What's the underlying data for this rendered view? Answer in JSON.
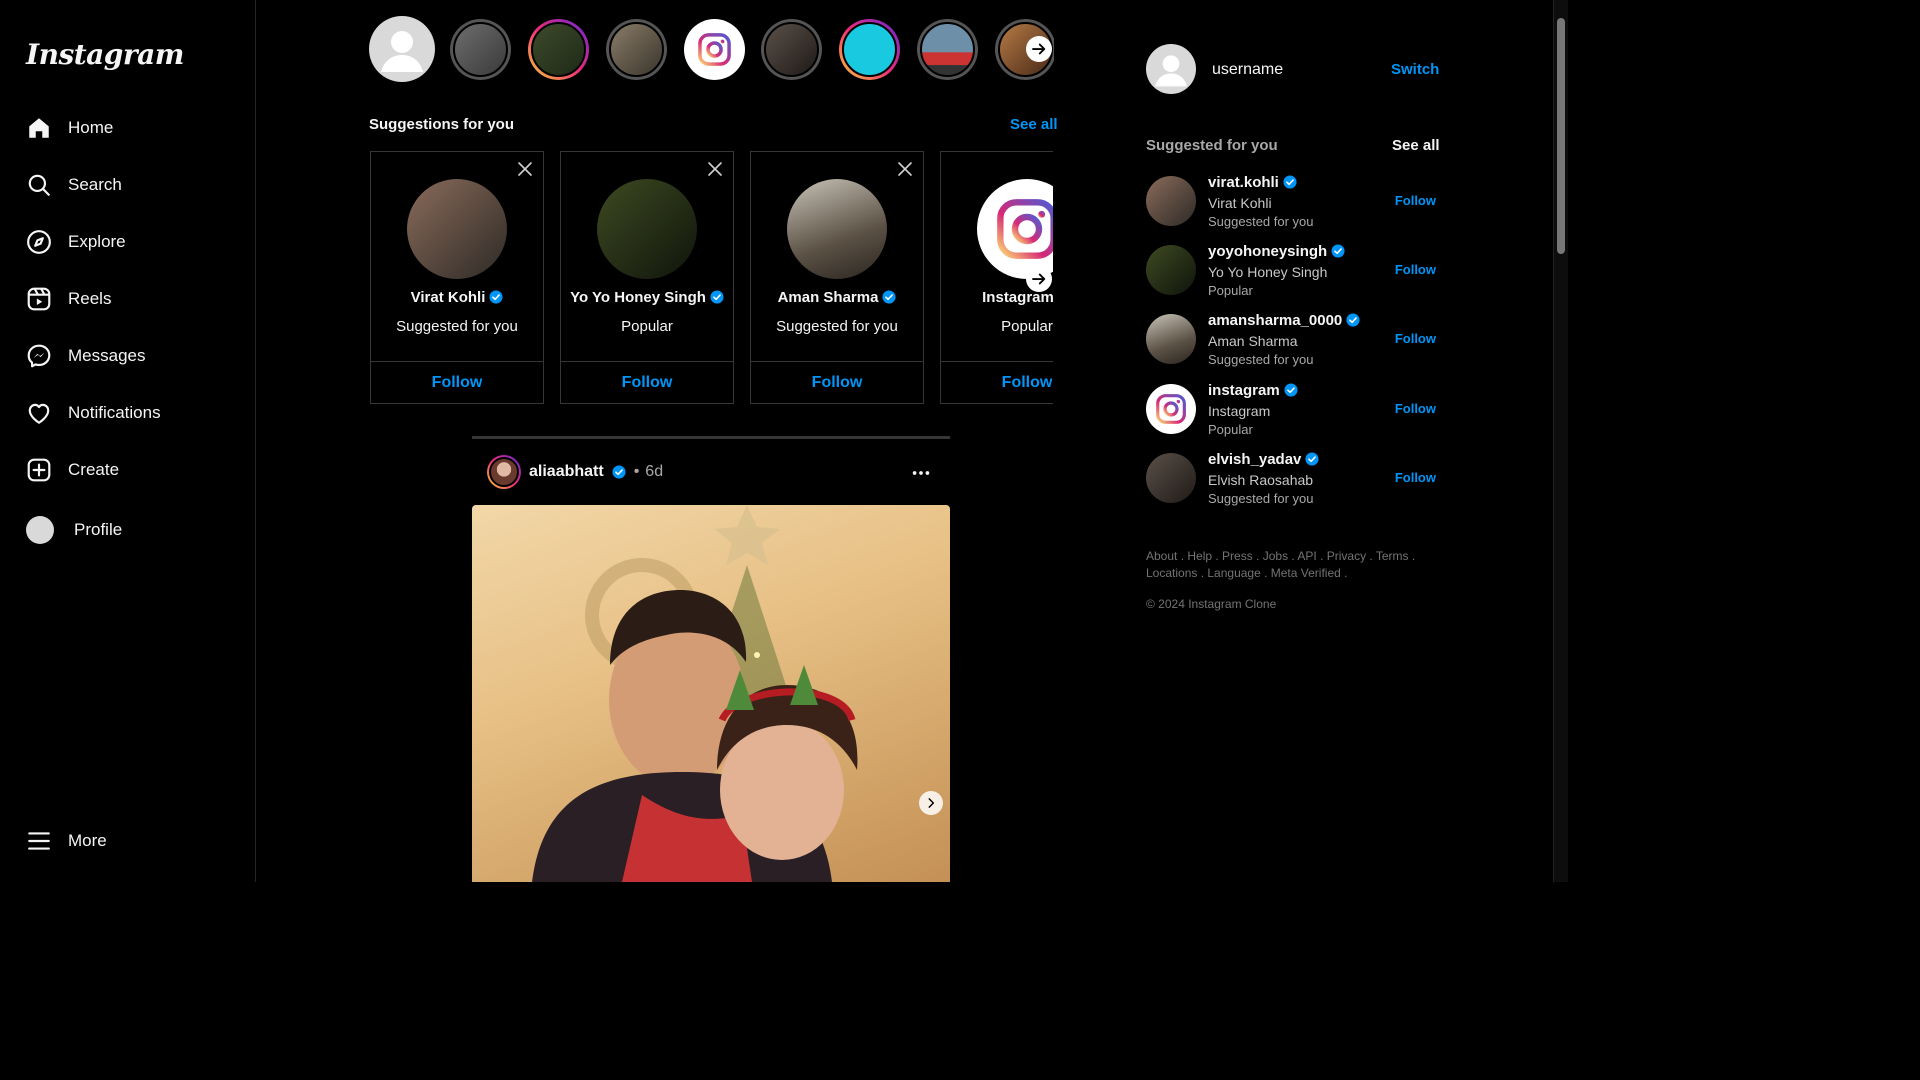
{
  "app": {
    "logo_text": "Instagram"
  },
  "sidebar": {
    "items": [
      {
        "label": "Home",
        "icon": "home-icon"
      },
      {
        "label": "Search",
        "icon": "search-icon"
      },
      {
        "label": "Explore",
        "icon": "compass-icon"
      },
      {
        "label": "Reels",
        "icon": "reels-icon"
      },
      {
        "label": "Messages",
        "icon": "messenger-icon"
      },
      {
        "label": "Notifications",
        "icon": "heart-icon"
      },
      {
        "label": "Create",
        "icon": "plus-square-icon"
      },
      {
        "label": "Profile",
        "icon": "avatar"
      }
    ],
    "more_label": "More"
  },
  "suggestions_row": {
    "title": "Suggestions for you",
    "see_all": "See all",
    "cards": [
      {
        "name": "Virat Kohli",
        "sub": "Suggested for you",
        "follow": "Follow",
        "verified": true
      },
      {
        "name": "Yo Yo Honey Singh",
        "sub": "Popular",
        "follow": "Follow",
        "verified": true
      },
      {
        "name": "Aman Sharma",
        "sub": "Suggested for you",
        "follow": "Follow",
        "verified": true
      },
      {
        "name": "Instagram",
        "sub": "Popular",
        "follow": "Follow",
        "verified": true
      }
    ]
  },
  "post": {
    "username": "aliaabhatt",
    "separator": "•",
    "time": "6d"
  },
  "right": {
    "username": "username",
    "switch_label": "Switch",
    "suggested_title": "Suggested for you",
    "see_all": "See all",
    "suggestions": [
      {
        "username": "virat.kohli",
        "name": "Virat Kohli",
        "sub": "Suggested for you",
        "follow": "Follow"
      },
      {
        "username": "yoyohoneysingh",
        "name": "Yo Yo Honey Singh",
        "sub": "Popular",
        "follow": "Follow"
      },
      {
        "username": "amansharma_0000",
        "name": "Aman Sharma",
        "sub": "Suggested for you",
        "follow": "Follow"
      },
      {
        "username": "instagram",
        "name": "Instagram",
        "sub": "Popular",
        "follow": "Follow"
      },
      {
        "username": "elvish_yadav",
        "name": "Elvish Raosahab",
        "sub": "Suggested for you",
        "follow": "Follow"
      }
    ],
    "footer_links": "About . Help . Press . Jobs . API . Privacy . Terms . Locations . Language . Meta Verified .",
    "copyright": "© 2024 Instagram Clone"
  },
  "colors": {
    "accent": "#0095f6",
    "background": "#000000",
    "border": "#363636"
  }
}
